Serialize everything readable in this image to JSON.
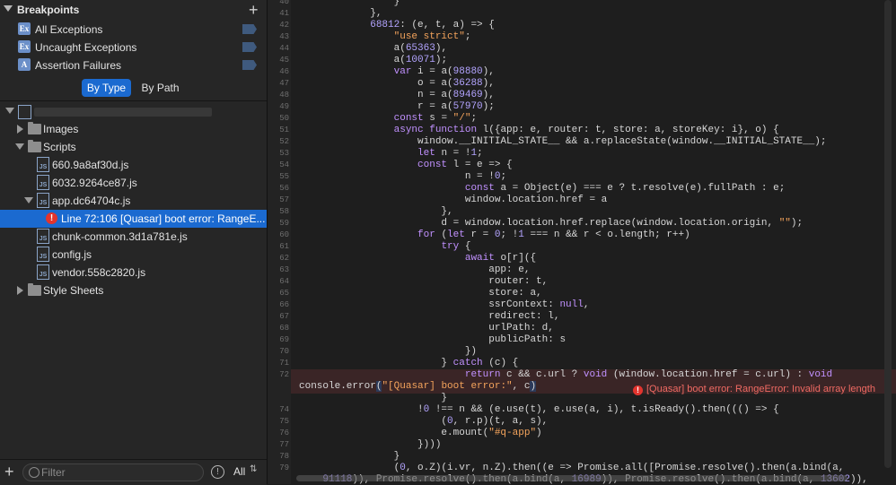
{
  "breakpoints": {
    "title": "Breakpoints",
    "items": [
      {
        "icon": "Ex",
        "label": "All Exceptions"
      },
      {
        "icon": "Ex",
        "label": "Uncaught Exceptions"
      },
      {
        "icon": "A",
        "label": "Assertion Failures"
      }
    ]
  },
  "view_toggle": {
    "by_type": "By Type",
    "by_path": "By Path",
    "selected": "By Type"
  },
  "tree": {
    "images": "Images",
    "scripts": "Scripts",
    "files": {
      "f1": "660.9a8af30d.js",
      "f2": "6032.9264ce87.js",
      "app": "app.dc64704c.js",
      "issue": "Line 72:106 [Quasar] boot error: RangeE...",
      "f3": "chunk-common.3d1a781e.js",
      "f4": "config.js",
      "f5": "vendor.558c2820.js"
    },
    "stylesheets": "Style Sheets"
  },
  "bottom_bar": {
    "filter_placeholder": "Filter",
    "scope": "All"
  },
  "editor": {
    "error_message": "[Quasar] boot error: RangeError: Invalid array length",
    "error_line": "72"
  },
  "colors": {
    "selection": "#1b6ad0",
    "error": "#e2342e",
    "string": "#f5a45c",
    "keyword": "#c191ff",
    "number": "#b3a4ff"
  }
}
